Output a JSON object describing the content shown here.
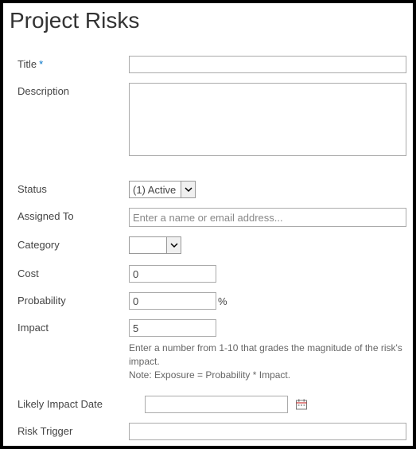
{
  "page_title": "Project Risks",
  "fields": {
    "title": {
      "label": "Title",
      "required_marker": "*",
      "value": ""
    },
    "description": {
      "label": "Description",
      "value": ""
    },
    "status": {
      "label": "Status",
      "value": "(1) Active"
    },
    "assigned_to": {
      "label": "Assigned To",
      "placeholder": "Enter a name or email address...",
      "value": ""
    },
    "category": {
      "label": "Category",
      "value": ""
    },
    "cost": {
      "label": "Cost",
      "value": "0"
    },
    "probability": {
      "label": "Probability",
      "value": "0",
      "unit": "%"
    },
    "impact": {
      "label": "Impact",
      "value": "5",
      "helper_line1": "Enter a number from 1-10 that grades the magnitude of the risk's impact.",
      "helper_line2": "Note: Exposure = Probability * Impact."
    },
    "likely_impact_date": {
      "label": "Likely Impact Date",
      "value": ""
    },
    "risk_trigger": {
      "label": "Risk Trigger",
      "value": ""
    }
  }
}
